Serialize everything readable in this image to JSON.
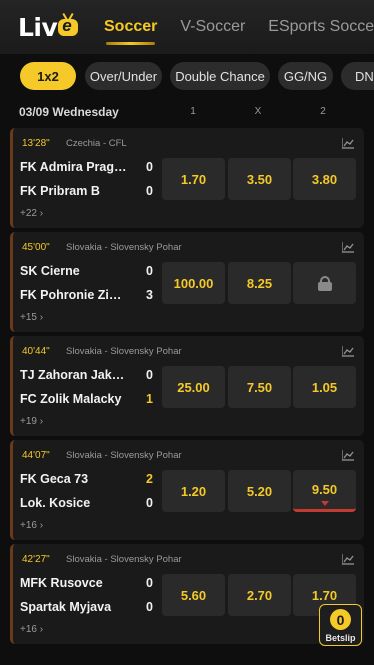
{
  "header": {
    "logo_text": "Liv",
    "logo_e": "e",
    "tabs": [
      {
        "label": "Soccer",
        "active": true
      },
      {
        "label": "V-Soccer",
        "active": false
      },
      {
        "label": "ESports Soccer",
        "active": false
      }
    ]
  },
  "markets": [
    {
      "label": "1x2",
      "active": true
    },
    {
      "label": "Over/Under",
      "active": false
    },
    {
      "label": "Double Chance",
      "active": false
    },
    {
      "label": "GG/NG",
      "active": false
    },
    {
      "label": "DN",
      "active": false
    }
  ],
  "date_header": {
    "date": "03/09 Wednesday",
    "col1": "1",
    "colx": "X",
    "col2": "2"
  },
  "matches": [
    {
      "time": "13'28\"",
      "league": "Czechia - CFL",
      "home": "FK Admira Prague",
      "away": "FK Pribram B",
      "home_score": "0",
      "away_score": "0",
      "more": "+22",
      "odds": [
        "1.70",
        "3.50",
        "3.80"
      ],
      "locked_index": null,
      "down_index": null
    },
    {
      "time": "45'00\"",
      "league": "Slovakia - Slovensky Pohar",
      "home": "SK Cierne",
      "away": "FK Pohronie Ziar nad Hronom",
      "home_score": "0",
      "away_score": "3",
      "more": "+15",
      "odds": [
        "100.00",
        "8.25",
        ""
      ],
      "locked_index": 2,
      "down_index": null
    },
    {
      "time": "40'44\"",
      "league": "Slovakia - Slovensky Pohar",
      "home": "TJ Zahoran Jakubov",
      "away": "FC Zolik Malacky",
      "home_score": "0",
      "away_score": "1",
      "more": "+19",
      "odds": [
        "25.00",
        "7.50",
        "1.05"
      ],
      "locked_index": null,
      "down_index": null
    },
    {
      "time": "44'07\"",
      "league": "Slovakia - Slovensky Pohar",
      "home": "FK Geca 73",
      "away": "Lok. Kosice",
      "home_score": "2",
      "away_score": "0",
      "more": "+16",
      "odds": [
        "1.20",
        "5.20",
        "9.50"
      ],
      "locked_index": null,
      "down_index": 2
    },
    {
      "time": "42'27\"",
      "league": "Slovakia - Slovensky Pohar",
      "home": "MFK Rusovce",
      "away": "Spartak Myjava",
      "home_score": "0",
      "away_score": "0",
      "more": "+16",
      "odds": [
        "5.60",
        "2.70",
        "1.70"
      ],
      "locked_index": null,
      "down_index": null
    }
  ],
  "betslip": {
    "count": "0",
    "label": "Betslip"
  },
  "colors": {
    "accent": "#f4c928",
    "background": "#0e0e0e",
    "card": "#1a1a1a",
    "odd_button": "#2a2a2a",
    "odds_down": "#c33a32"
  }
}
